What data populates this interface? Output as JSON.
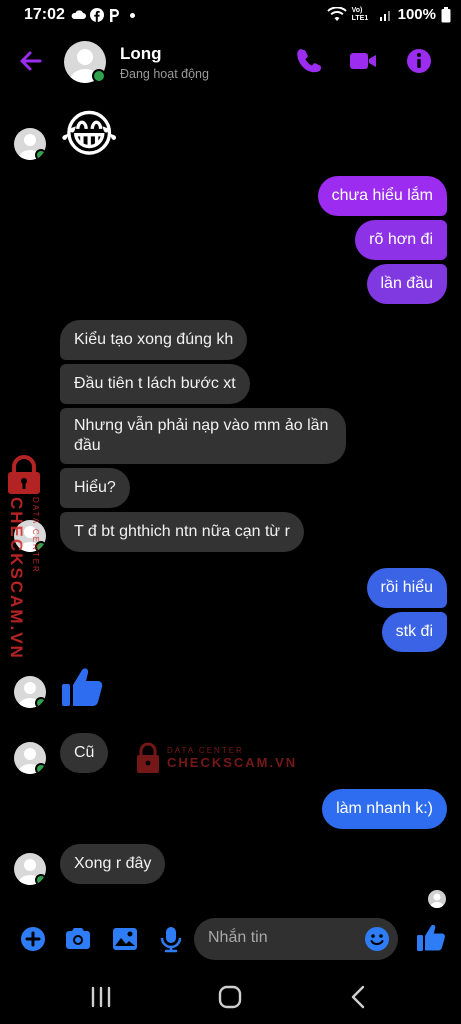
{
  "status_bar": {
    "time": "17:02",
    "battery": "100%",
    "network": "Vo) LTE1"
  },
  "header": {
    "name": "Long",
    "status": "Đang hoạt động"
  },
  "messages": [
    {
      "dir": "in",
      "type": "emoji",
      "text": "😂"
    },
    {
      "dir": "out",
      "text": "chưa hiểu lắm"
    },
    {
      "dir": "out",
      "text": "rõ hơn đi"
    },
    {
      "dir": "out",
      "text": "lần đầu"
    },
    {
      "dir": "in",
      "text": "Kiểu tạo xong đúng kh"
    },
    {
      "dir": "in",
      "text": "Đầu tiên t lách bước xt"
    },
    {
      "dir": "in",
      "text_line1": "Nhưng vẫn phải nạp vào mm ảo lần",
      "text_line2": "đầu"
    },
    {
      "dir": "in",
      "text": "Hiểu?"
    },
    {
      "dir": "in",
      "text": "T đ bt ghthich ntn nữa cạn từ r"
    },
    {
      "dir": "out",
      "text": "rồi hiểu"
    },
    {
      "dir": "out",
      "text": "stk đi"
    },
    {
      "dir": "in",
      "type": "like"
    },
    {
      "dir": "in",
      "text": "Cũ"
    },
    {
      "dir": "out",
      "text": "làm nhanh k:)"
    },
    {
      "dir": "in",
      "text": "Xong r đây"
    }
  ],
  "composer": {
    "placeholder": "Nhắn tin"
  },
  "watermark": {
    "small": "DATA CENTER",
    "big": "CHECKSCAM.VN"
  },
  "colors": {
    "accent_purple": "#9b2cf0",
    "bubble_purple": "#8a2be2",
    "bubble_blue": "#2f6df0",
    "incoming_bubble": "#333333",
    "watermark_red": "#d42a2a"
  }
}
